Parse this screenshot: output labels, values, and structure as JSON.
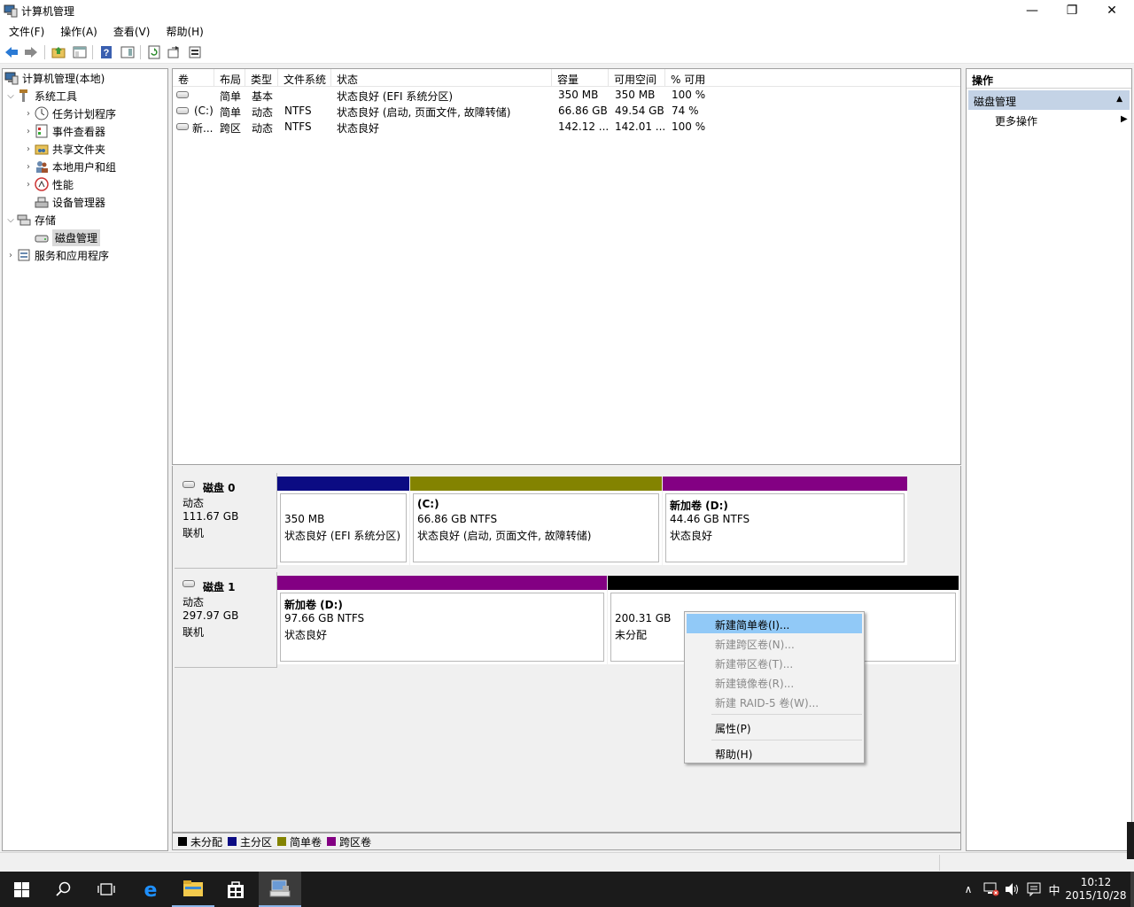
{
  "window": {
    "title": "计算机管理",
    "minimize_glyph": "—",
    "restore_glyph": "❐",
    "close_glyph": "✕"
  },
  "menu": [
    "文件(F)",
    "操作(A)",
    "查看(V)",
    "帮助(H)"
  ],
  "toolbar": {
    "icons": [
      "back-icon",
      "forward-icon",
      "up-folder-icon",
      "show-hide-tree-icon",
      "help-icon",
      "properties-pane-icon",
      "refresh-icon",
      "export-icon",
      "disk-properties-icon"
    ]
  },
  "tree": {
    "root": "计算机管理(本地)",
    "items": [
      {
        "label": "系统工具",
        "level": 1,
        "expanded": true
      },
      {
        "label": "任务计划程序",
        "level": 2,
        "expandable": true
      },
      {
        "label": "事件查看器",
        "level": 2,
        "expandable": true
      },
      {
        "label": "共享文件夹",
        "level": 2,
        "expandable": true
      },
      {
        "label": "本地用户和组",
        "level": 2,
        "expandable": true
      },
      {
        "label": "性能",
        "level": 2,
        "expandable": true
      },
      {
        "label": "设备管理器",
        "level": 2,
        "expandable": false
      },
      {
        "label": "存储",
        "level": 1,
        "expanded": true
      },
      {
        "label": "磁盘管理",
        "level": 2,
        "expandable": false,
        "selected": true
      },
      {
        "label": "服务和应用程序",
        "level": 1,
        "expandable": true
      }
    ]
  },
  "volume_list": {
    "columns": [
      "卷",
      "布局",
      "类型",
      "文件系统",
      "状态",
      "容量",
      "可用空间",
      "% 可用"
    ],
    "rows": [
      [
        "",
        "简单",
        "基本",
        "",
        "状态良好 (EFI 系统分区)",
        "350 MB",
        "350 MB",
        "100 %"
      ],
      [
        "(C:)",
        "简单",
        "动态",
        "NTFS",
        "状态良好 (启动, 页面文件, 故障转储)",
        "66.86 GB",
        "49.54 GB",
        "74 %"
      ],
      [
        "新...",
        "跨区",
        "动态",
        "NTFS",
        "状态良好",
        "142.12 ...",
        "142.01 ...",
        "100 %"
      ]
    ]
  },
  "disks": [
    {
      "name": "磁盘 0",
      "type": "动态",
      "size": "111.67 GB",
      "status": "联机",
      "partitions": [
        {
          "title": "",
          "line1": "350 MB",
          "line2": "状态良好 (EFI 系统分区)",
          "color": "#0b0b83"
        },
        {
          "title": "(C:)",
          "line1": "66.86 GB NTFS",
          "line2": "状态良好 (启动, 页面文件, 故障转储)",
          "color": "#838300"
        },
        {
          "title": "新加卷  (D:)",
          "line1": "44.46 GB NTFS",
          "line2": "状态良好",
          "color": "#830083"
        }
      ]
    },
    {
      "name": "磁盘 1",
      "type": "动态",
      "size": "297.97 GB",
      "status": "联机",
      "partitions": [
        {
          "title": "新加卷  (D:)",
          "line1": "97.66 GB NTFS",
          "line2": "状态良好",
          "color": "#830083"
        },
        {
          "title": "",
          "line1": "200.31 GB",
          "line2": "未分配",
          "color": "#000000"
        }
      ]
    }
  ],
  "legend": [
    {
      "label": "未分配",
      "color": "#000000"
    },
    {
      "label": "主分区",
      "color": "#0b0b83"
    },
    {
      "label": "简单卷",
      "color": "#838300"
    },
    {
      "label": "跨区卷",
      "color": "#830083"
    }
  ],
  "actions": {
    "header": "操作",
    "section": "磁盘管理",
    "more": "更多操作"
  },
  "context_menu": [
    {
      "label": "新建简单卷(I)...",
      "state": "highlighted"
    },
    {
      "label": "新建跨区卷(N)...",
      "state": "disabled"
    },
    {
      "label": "新建带区卷(T)...",
      "state": "disabled"
    },
    {
      "label": "新建镜像卷(R)...",
      "state": "disabled"
    },
    {
      "label": "新建 RAID-5 卷(W)...",
      "state": "disabled"
    },
    {
      "label": "属性(P)",
      "state": "enabled"
    },
    {
      "label": "帮助(H)",
      "state": "enabled"
    }
  ],
  "taskbar": {
    "ime": "中",
    "time": "10:12",
    "date": "2015/10/28"
  }
}
